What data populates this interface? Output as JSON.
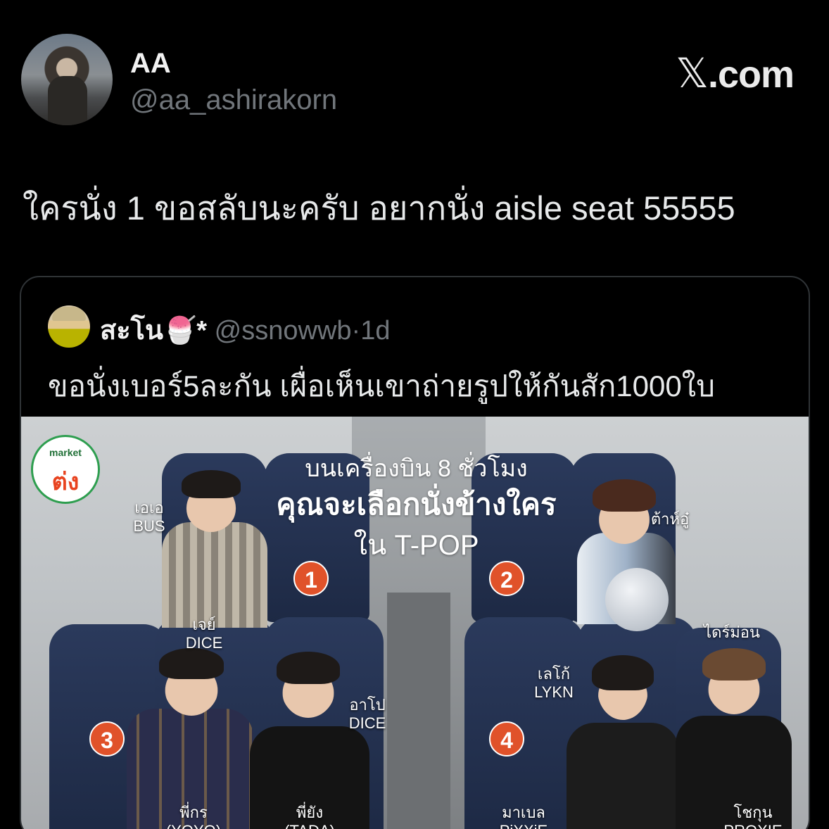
{
  "post": {
    "author_name": "AA",
    "author_handle": "@aa_ashirakorn",
    "brand": ".com",
    "brand_glyph": "𝕏",
    "text": "ใครนั่ง 1 ขอสลับนะครับ อยากนั่ง aisle seat 55555"
  },
  "quote": {
    "author_name": "สะโน🍧*",
    "author_handle": "@ssnowwb",
    "separator": "·",
    "age": "1d",
    "text": "ขอนั่งเบอร์5ละกัน เผื่อเห็นเขาถ่ายรูปให้กันสัก1000ใบ"
  },
  "media": {
    "logo_top": "market",
    "logo_main": "ต่ง",
    "title_line1": "บนเครื่องบิน 8 ชั่วโมง",
    "title_line2": "คุณจะเลือกนั่งข้างใคร",
    "title_line3": "ใน T-POP",
    "badges": [
      "1",
      "2",
      "3",
      "4"
    ],
    "labels": {
      "aa_bus": [
        "เอเอ",
        "BUS"
      ],
      "jay_dice": [
        "เจย์",
        "DICE"
      ],
      "tahoo": [
        "ต้าห์อู๋"
      ],
      "diamond": [
        "ไดร์ม่อน"
      ],
      "leo_lykn": [
        "เลโก้",
        "LYKN"
      ],
      "apo_dice": [
        "อาโป",
        "DICE"
      ],
      "phikorn": [
        "พี่กร",
        "(YOYO)"
      ],
      "phiyang": [
        "พี่ยัง",
        "(TADA)"
      ],
      "mabel": [
        "มาเบล",
        "PiXXiE"
      ],
      "chokun": [
        "โชกุน",
        "PROXIE"
      ]
    }
  },
  "colors": {
    "background": "#000000",
    "text_primary": "#e7e9ea",
    "text_secondary": "#71767b",
    "badge": "#e0522a",
    "border": "#2f3336"
  }
}
